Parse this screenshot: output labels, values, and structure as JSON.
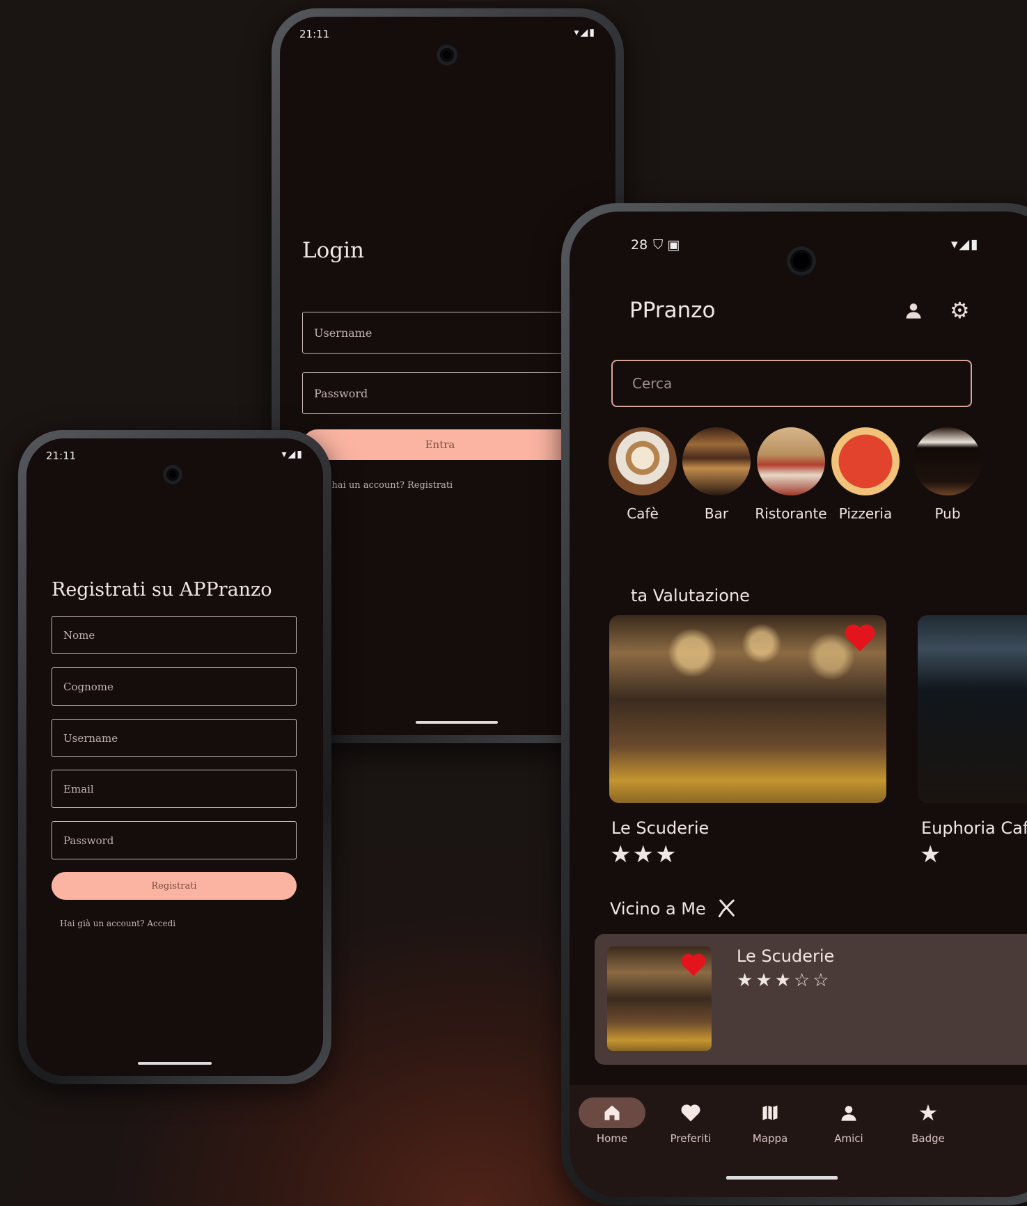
{
  "register": {
    "status_time": "21:11",
    "title": "Registrati su APPranzo",
    "fields": [
      "Nome",
      "Cognome",
      "Username",
      "Email",
      "Password"
    ],
    "button": "Registrati",
    "footer": "Hai già un account? Accedi"
  },
  "login": {
    "status_time": "21:11",
    "title": "Login",
    "username_placeholder": "Username",
    "password_placeholder": "Password",
    "button": "Entra",
    "footer": "n hai un account? Registrati"
  },
  "home": {
    "status_time": "28",
    "app_title": "PPranzo",
    "search_placeholder": "Cerca",
    "categories": [
      "Cafè",
      "Bar",
      "Ristorante",
      "Pizzeria",
      "Pub"
    ],
    "section_top": "ta Valutazione",
    "top_cards": [
      {
        "name": "Le Scuderie",
        "rating": 3,
        "favorite": true
      },
      {
        "name": "Euphoria Caf",
        "rating": 1,
        "favorite": false
      }
    ],
    "section_near": "Vicino a Me",
    "near_item": {
      "name": "Le Scuderie",
      "rating": 3,
      "max": 5,
      "favorite": true
    },
    "nav": [
      "Home",
      "Preferiti",
      "Mappa",
      "Amici",
      "Badge"
    ],
    "nav_active": "Home",
    "colors": {
      "accent": "#fbb4a2",
      "background": "#150d0c",
      "card": "#4b3b38",
      "heart": "#e3141b"
    }
  }
}
